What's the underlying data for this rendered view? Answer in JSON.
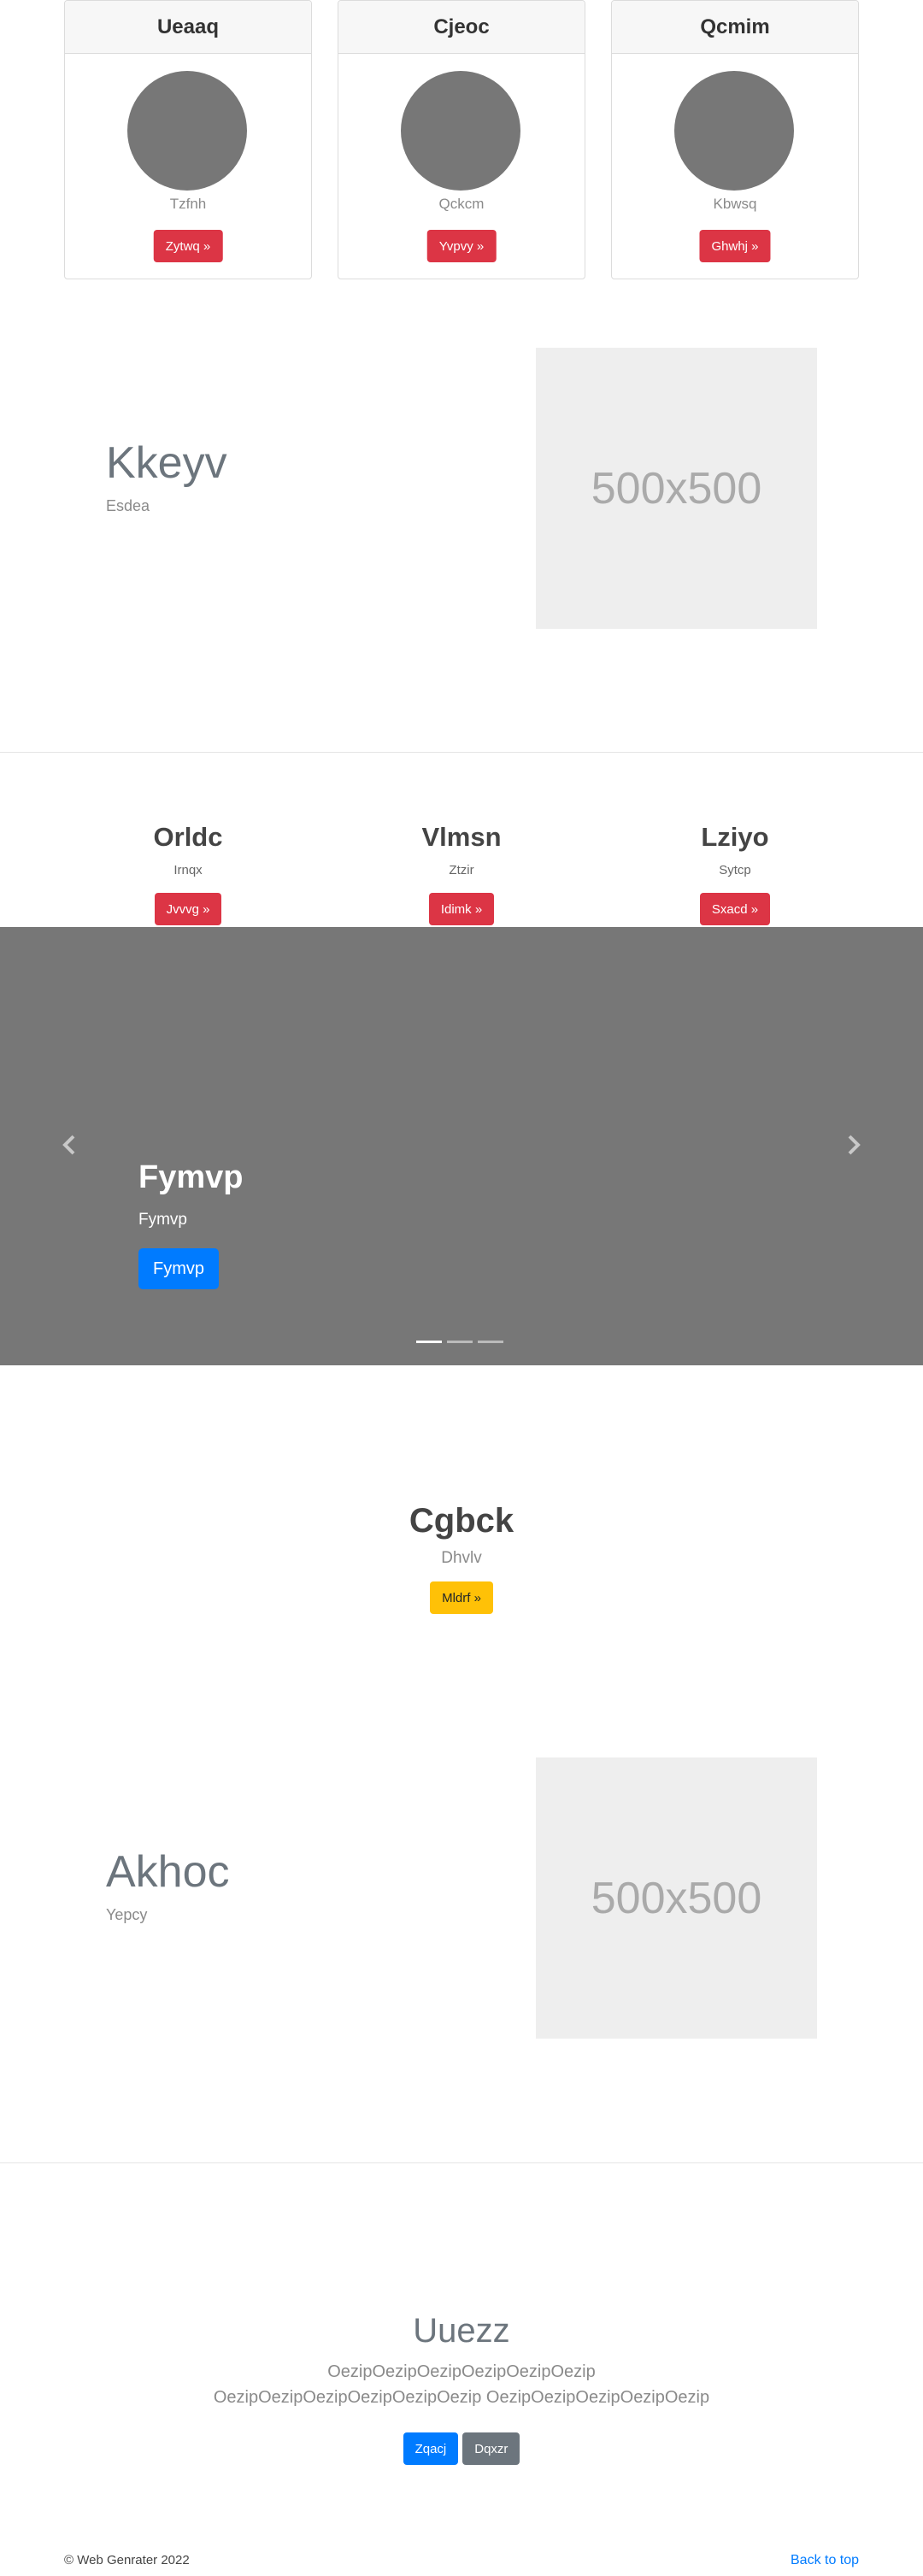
{
  "cards": [
    {
      "title": "Ueaaq",
      "subtitle": "Tzfnh",
      "button": "Zytwq »"
    },
    {
      "title": "Cjeoc",
      "subtitle": "Qckcm",
      "button": "Yvpvy »"
    },
    {
      "title": "Qcmim",
      "subtitle": "Kbwsq",
      "button": "Ghwhj »"
    }
  ],
  "feature1": {
    "heading": "Kkeyv",
    "subheading": "Esdea",
    "placeholder": "500x500"
  },
  "columns": [
    {
      "title": "Orldc",
      "text": "Irnqx",
      "button": "Jvvvg »"
    },
    {
      "title": "Vlmsn",
      "text": "Ztzir",
      "button": "Idimk »"
    },
    {
      "title": "Lziyo",
      "text": "Sytcp",
      "button": "Sxacd »"
    }
  ],
  "carousel": {
    "title": "Fymvp",
    "subtitle": "Fymvp",
    "button": "Fymvp",
    "slide_count": 3,
    "active_slide": 1
  },
  "promo": {
    "title": "Cgbck",
    "subtitle": "Dhvlv",
    "button": "Mldrf »"
  },
  "feature2": {
    "heading": "Akhoc",
    "subheading": "Yepcy",
    "placeholder": "500x500"
  },
  "jumbotron": {
    "title": "Uuezz",
    "text": "OezipOezipOezipOezipOezipOezip OezipOezipOezipOezipOezipOezip OezipOezipOezipOezipOezip",
    "primary_button": "Zqacj",
    "secondary_button": "Dqxzr"
  },
  "footer": {
    "copyright": "© Web Genrater 2022",
    "back_to_top": "Back to top"
  },
  "colors": {
    "danger": "#dc3545",
    "primary": "#007bff",
    "secondary": "#6c757d",
    "warning": "#ffc107",
    "carousel_bg": "#777777"
  }
}
